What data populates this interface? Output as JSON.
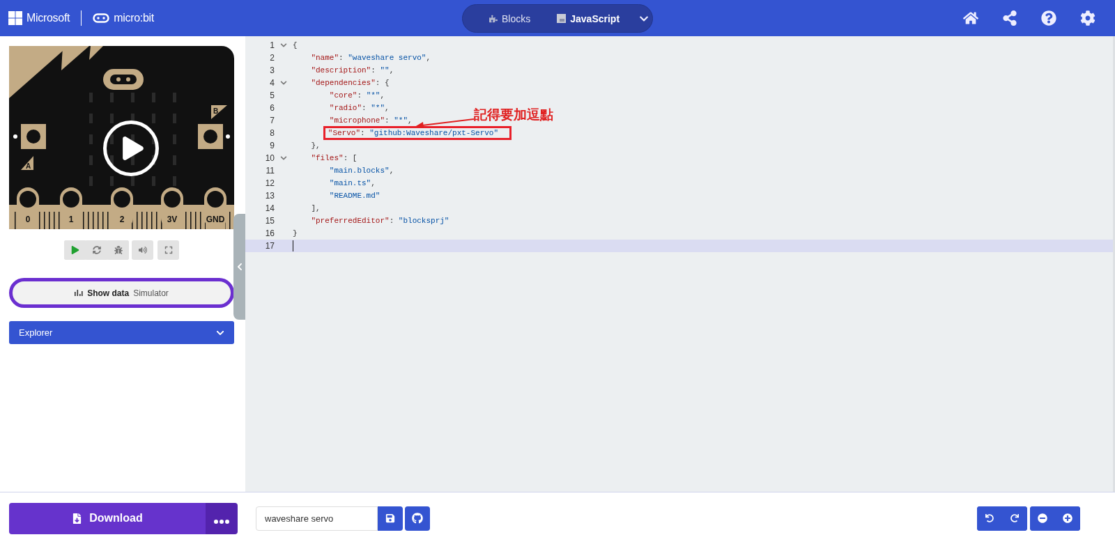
{
  "header": {
    "brand": "Microsoft",
    "product": "micro:bit",
    "tabs": [
      {
        "label": "Blocks",
        "kind": "blocks",
        "selected": false
      },
      {
        "label": "JavaScript",
        "kind": "javascript",
        "selected": true
      }
    ]
  },
  "simulator": {
    "pins": [
      "0",
      "1",
      "2",
      "3V",
      "GND"
    ],
    "buttons": [
      "A",
      "B"
    ],
    "show_data": {
      "label": "Show data",
      "sublabel": "Simulator"
    }
  },
  "explorer": {
    "label": "Explorer",
    "expanded": false
  },
  "editor": {
    "lines": [
      {
        "number": "1",
        "foldable": true,
        "tokens": [
          {
            "kind": "punct",
            "text": "{"
          }
        ]
      },
      {
        "number": "2",
        "foldable": false,
        "tokens": [
          {
            "kind": "key",
            "text": "    \"name\""
          },
          {
            "kind": "punct",
            "text": ": "
          },
          {
            "kind": "string",
            "text": "\"waveshare servo\""
          },
          {
            "kind": "punct",
            "text": ","
          }
        ]
      },
      {
        "number": "3",
        "foldable": false,
        "tokens": [
          {
            "kind": "key",
            "text": "    \"description\""
          },
          {
            "kind": "punct",
            "text": ": "
          },
          {
            "kind": "string",
            "text": "\"\""
          },
          {
            "kind": "punct",
            "text": ","
          }
        ]
      },
      {
        "number": "4",
        "foldable": true,
        "tokens": [
          {
            "kind": "key",
            "text": "    \"dependencies\""
          },
          {
            "kind": "punct",
            "text": ": {"
          }
        ]
      },
      {
        "number": "5",
        "foldable": false,
        "tokens": [
          {
            "kind": "key",
            "text": "        \"core\""
          },
          {
            "kind": "punct",
            "text": ": "
          },
          {
            "kind": "string",
            "text": "\"*\""
          },
          {
            "kind": "punct",
            "text": ","
          }
        ]
      },
      {
        "number": "6",
        "foldable": false,
        "tokens": [
          {
            "kind": "key",
            "text": "        \"radio\""
          },
          {
            "kind": "punct",
            "text": ": "
          },
          {
            "kind": "string",
            "text": "\"*\""
          },
          {
            "kind": "punct",
            "text": ","
          }
        ]
      },
      {
        "number": "7",
        "foldable": false,
        "note": "記得要加逗點",
        "tokens": [
          {
            "kind": "key",
            "text": "        \"microphone\""
          },
          {
            "kind": "punct",
            "text": ": "
          },
          {
            "kind": "string",
            "text": "\"*\""
          },
          {
            "kind": "punct",
            "text": ","
          }
        ]
      },
      {
        "number": "8",
        "foldable": false,
        "highlighted": true,
        "tokens": [
          {
            "kind": "key",
            "text": "        \"Servo\""
          },
          {
            "kind": "punct",
            "text": ": "
          },
          {
            "kind": "string",
            "text": "\"github:Waveshare/pxt-Servo\""
          }
        ]
      },
      {
        "number": "9",
        "foldable": false,
        "tokens": [
          {
            "kind": "punct",
            "text": "    },"
          }
        ]
      },
      {
        "number": "10",
        "foldable": true,
        "tokens": [
          {
            "kind": "key",
            "text": "    \"files\""
          },
          {
            "kind": "punct",
            "text": ": ["
          }
        ]
      },
      {
        "number": "11",
        "foldable": false,
        "tokens": [
          {
            "kind": "string",
            "text": "        \"main.blocks\""
          },
          {
            "kind": "punct",
            "text": ","
          }
        ]
      },
      {
        "number": "12",
        "foldable": false,
        "tokens": [
          {
            "kind": "string",
            "text": "        \"main.ts\""
          },
          {
            "kind": "punct",
            "text": ","
          }
        ]
      },
      {
        "number": "13",
        "foldable": false,
        "tokens": [
          {
            "kind": "string",
            "text": "        \"README.md\""
          }
        ]
      },
      {
        "number": "14",
        "foldable": false,
        "tokens": [
          {
            "kind": "punct",
            "text": "    ],"
          }
        ]
      },
      {
        "number": "15",
        "foldable": false,
        "tokens": [
          {
            "kind": "key",
            "text": "    \"preferredEditor\""
          },
          {
            "kind": "punct",
            "text": ": "
          },
          {
            "kind": "string",
            "text": "\"blocksprj\""
          }
        ]
      },
      {
        "number": "16",
        "foldable": false,
        "tokens": [
          {
            "kind": "punct",
            "text": "}"
          }
        ]
      },
      {
        "number": "17",
        "foldable": false,
        "current": true
      }
    ]
  },
  "footer": {
    "download": "Download",
    "project_name": "waveshare servo"
  }
}
